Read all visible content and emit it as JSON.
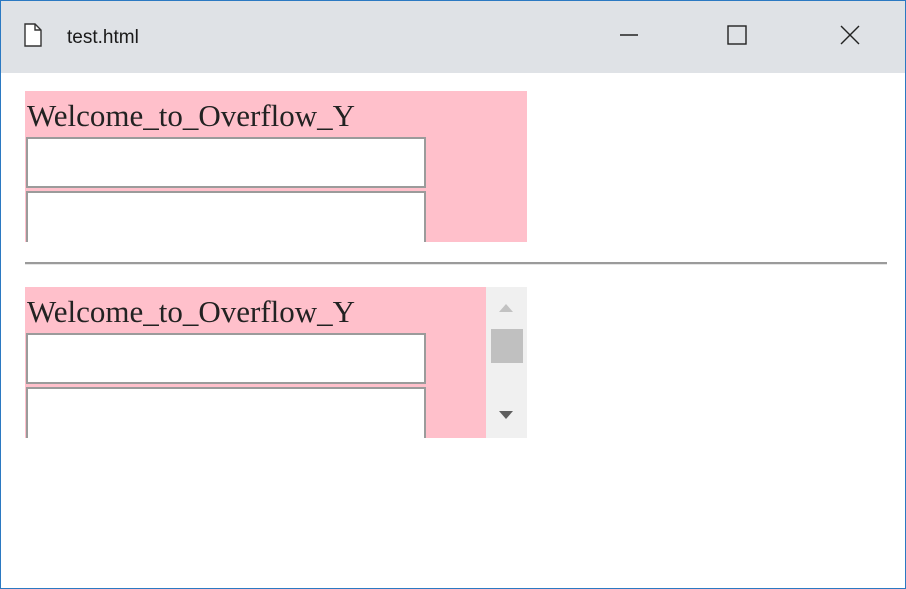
{
  "window": {
    "title": "test.html",
    "doc_icon": "document-icon",
    "controls": {
      "minimize_icon": "minimize-icon",
      "maximize_icon": "maximize-icon",
      "close_icon": "close-icon"
    }
  },
  "sections": [
    {
      "label": "Welcome_to_Overflow_Y",
      "inputs": [
        {
          "value": "",
          "placeholder": ""
        },
        {
          "value": "",
          "placeholder": ""
        }
      ],
      "scrollbar": false
    },
    {
      "label": "Welcome_to_Overflow_Y",
      "inputs": [
        {
          "value": "",
          "placeholder": ""
        },
        {
          "value": "",
          "placeholder": ""
        }
      ],
      "scrollbar": true
    }
  ],
  "colors": {
    "box_background": "#ffc0cb",
    "titlebar_background": "#dfe2e6",
    "window_border": "#2b79c2"
  }
}
